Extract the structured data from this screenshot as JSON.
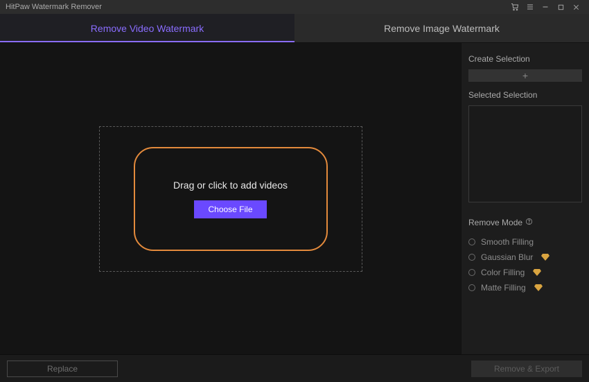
{
  "titlebar": {
    "title": "HitPaw Watermark Remover"
  },
  "tabs": {
    "video": "Remove Video Watermark",
    "image": "Remove Image Watermark"
  },
  "dropzone": {
    "text": "Drag or click to add videos",
    "choose_label": "Choose File"
  },
  "sidebar": {
    "create_label": "Create Selection",
    "add_glyph": "+",
    "selected_label": "Selected Selection",
    "mode_label": "Remove Mode",
    "modes": [
      {
        "label": "Smooth Filling",
        "premium": false
      },
      {
        "label": "Gaussian Blur",
        "premium": true
      },
      {
        "label": "Color Filling",
        "premium": true
      },
      {
        "label": "Matte Filling",
        "premium": true
      }
    ]
  },
  "footer": {
    "replace": "Replace",
    "export": "Remove & Export"
  }
}
